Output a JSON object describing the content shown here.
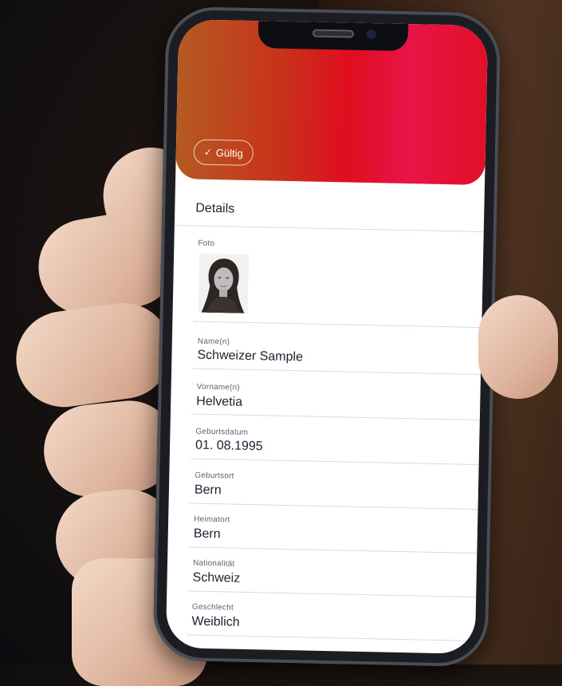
{
  "status_badge": {
    "icon": "check-icon",
    "label": "Gültig"
  },
  "details": {
    "title": "Details",
    "photo_label": "Foto",
    "fields": [
      {
        "label": "Name(n)",
        "value": "Schweizer Sample"
      },
      {
        "label": "Vorname(n)",
        "value": "Helvetia"
      },
      {
        "label": "Geburtsdatum",
        "value": "01. 08.1995"
      },
      {
        "label": "Geburtsort",
        "value": "Bern"
      },
      {
        "label": "Heimatort",
        "value": "Bern"
      },
      {
        "label": "Nationalität",
        "value": "Schweiz"
      },
      {
        "label": "Geschlecht",
        "value": "Weiblich"
      }
    ]
  },
  "colors": {
    "banner_start": "#b55a22",
    "banner_mid": "#e00d1e",
    "banner_end": "#e81448",
    "text": "#1b2230"
  }
}
